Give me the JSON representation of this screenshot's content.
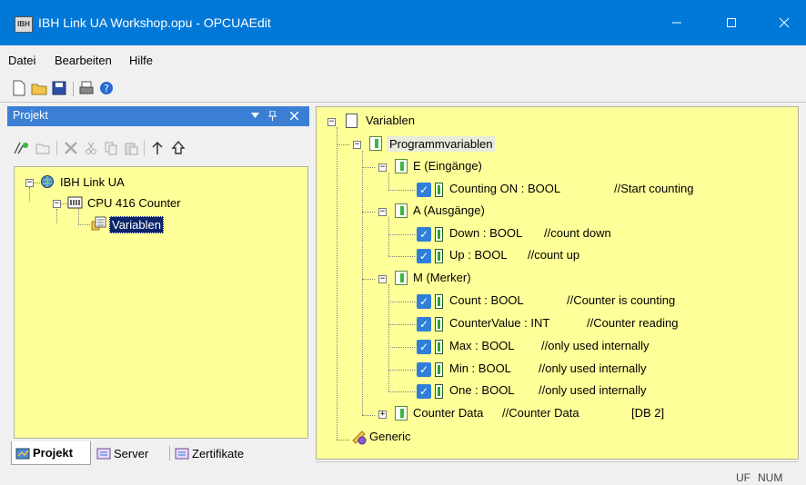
{
  "window": {
    "title": "IBH Link UA Workshop.opu - OPCUAEdit",
    "app_icon_text": "IBH"
  },
  "menu": [
    "Datei",
    "Bearbeiten",
    "Hilfe"
  ],
  "panel": {
    "title": "Projekt"
  },
  "left_tree": {
    "root": "IBH Link UA",
    "device": "CPU 416 Counter",
    "selected": "Variablen"
  },
  "right_tree": {
    "root": "Variablen",
    "program": "Programmvariablen",
    "groups": [
      {
        "label": "E (Eingänge)",
        "items": [
          {
            "name": "Counting ON : BOOL",
            "comment": "//Start counting"
          }
        ]
      },
      {
        "label": "A (Ausgänge)",
        "items": [
          {
            "name": "Down : BOOL",
            "comment": "//count down"
          },
          {
            "name": "Up : BOOL",
            "comment": "//count up"
          }
        ]
      },
      {
        "label": "M (Merker)",
        "items": [
          {
            "name": "Count : BOOL",
            "comment": "//Counter is counting"
          },
          {
            "name": "CounterValue : INT",
            "comment": "//Counter reading"
          },
          {
            "name": "Max : BOOL",
            "comment": "//only used internally"
          },
          {
            "name": "Min : BOOL",
            "comment": "//only used internally"
          },
          {
            "name": "One : BOOL",
            "comment": "//only used internally"
          }
        ]
      }
    ],
    "counter_data": {
      "name": "Counter Data",
      "comment": "//Counter Data",
      "block": "[DB 2]"
    },
    "generic": "Generic"
  },
  "tabs": [
    "Projekt",
    "Server",
    "Zertifikate"
  ],
  "status": {
    "uf": "UF",
    "num": "NUM"
  },
  "colors": {
    "titlebar": "#0078d7",
    "panel_header": "#3a7fd4",
    "tree_bg": "#ffff99",
    "checkbox": "#2f7fd8",
    "selection": "#0a246a"
  }
}
